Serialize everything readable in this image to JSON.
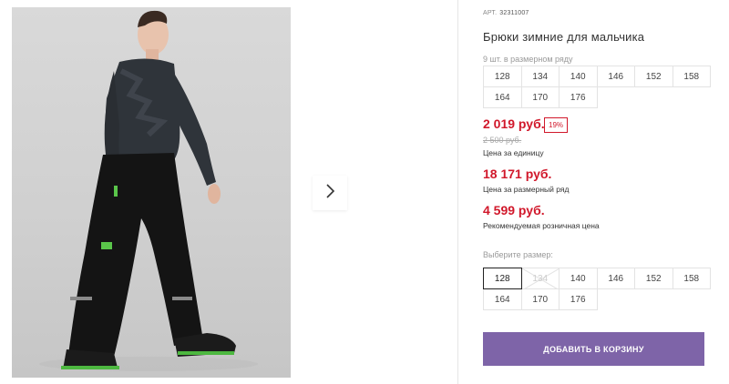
{
  "product": {
    "article_label": "АРТ.",
    "article_value": "32311007",
    "title": "Брюки зимние для мальчика",
    "pack_note": "9 шт. в размерном ряду",
    "pack_sizes": [
      "128",
      "134",
      "140",
      "146",
      "152",
      "158",
      "164",
      "170",
      "176"
    ]
  },
  "pricing": {
    "unit_price": "2 019 руб.",
    "discount_badge": "19%",
    "old_price": "2 500 руб.",
    "unit_label": "Цена за единицу",
    "pack_price": "18 171 руб.",
    "pack_label": "Цена за размерный ряд",
    "retail_price": "4 599 руб.",
    "retail_label": "Рекомендуемая розничная цена"
  },
  "size_picker": {
    "label": "Выберите размер:",
    "options": [
      "128",
      "134",
      "140",
      "146",
      "152",
      "158",
      "164",
      "170",
      "176"
    ],
    "selected": "128",
    "unavailable": [
      "134"
    ]
  },
  "actions": {
    "add_to_cart": "ДОБАВИТЬ В КОРЗИНУ"
  },
  "colors": {
    "price_red": "#d1182b",
    "button_purple": "#7e64a8"
  },
  "icons": {
    "next": "chevron-right-icon"
  }
}
